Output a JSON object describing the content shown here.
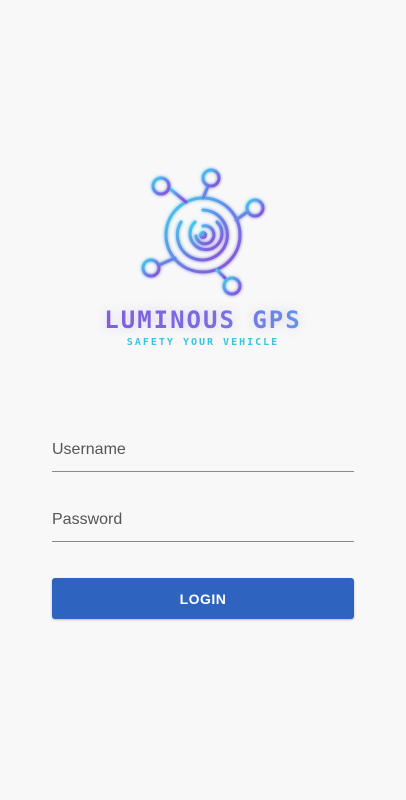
{
  "branding": {
    "app_name": "LUMINOUS GPS",
    "tagline": "SAFETY YOUR VEHICLE",
    "colors": {
      "purple": "#8a4fd6",
      "blue": "#3fd1f0",
      "cyan": "#33c6e8"
    }
  },
  "login_form": {
    "username_placeholder": "Username",
    "password_placeholder": "Password",
    "login_label": "LOGIN",
    "button_color": "#2e64bf"
  }
}
